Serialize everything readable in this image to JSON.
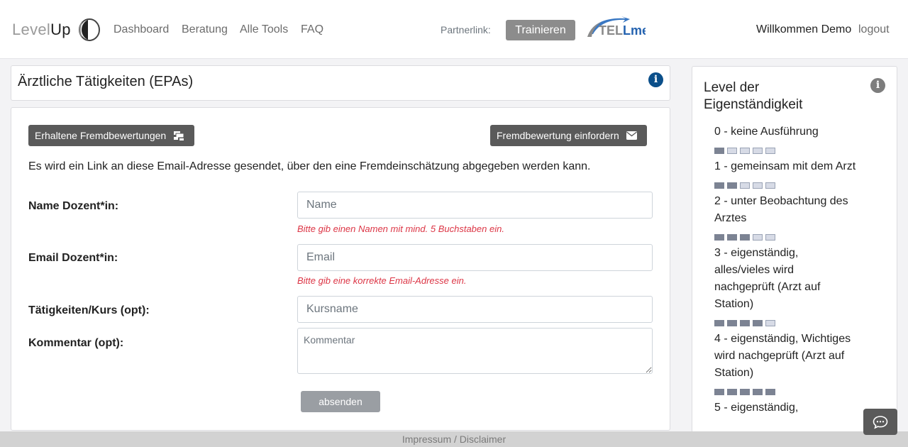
{
  "logo": {
    "level": "Level",
    "up": "Up"
  },
  "nav": {
    "links": [
      "Dashboard",
      "Beratung",
      "Alle Tools",
      "FAQ"
    ],
    "partner_label": "Partnerlink:",
    "train_button": "Trainieren",
    "partner_logo": {
      "tel": "TEL",
      "lme": "Lme"
    },
    "welcome": "Willkommen Demo",
    "logout": "logout"
  },
  "page": {
    "title": "Ärztliche Tätigkeiten (EPAs)"
  },
  "form": {
    "received_button": "Erhaltene Fremdbewertungen",
    "request_button": "Fremdbewertung einfordern",
    "intro": "Es wird ein Link an diese Email-Adresse gesendet, über den eine Fremdeinschätzung abgegeben werden kann.",
    "name_label": "Name Dozent*in:",
    "name_placeholder": "Name",
    "name_error": "Bitte gib einen Namen mit mind. 5 Buchstaben ein.",
    "email_label": "Email Dozent*in:",
    "email_placeholder": "Email",
    "email_error": "Bitte gib eine korrekte Email-Adresse ein.",
    "course_label": "Tätigkeiten/Kurs (opt):",
    "course_placeholder": "Kursname",
    "comment_label": "Kommentar (opt):",
    "comment_placeholder": "Kommentar",
    "submit": "absenden"
  },
  "sidebar": {
    "title": "Level der Eigenständigkeit",
    "levels": [
      {
        "label": "0 - keine Ausführung",
        "filled": 0
      },
      {
        "label": "1 - gemeinsam mit dem Arzt",
        "filled": 1
      },
      {
        "label": "2 - unter Beobachtung des Arztes",
        "filled": 2
      },
      {
        "label": "3 - eigenständig, alles/vieles wird nachgeprüft (Arzt auf Station)",
        "filled": 3
      },
      {
        "label": "4 - eigenständig, Wichtiges wird nachgeprüft (Arzt auf Station)",
        "filled": 4
      },
      {
        "label": "5 - eigenständig,",
        "filled": 5
      }
    ],
    "squares_total": 5
  },
  "footer": {
    "text": "Impressum / Disclaimer"
  },
  "icons": [
    "info-icon",
    "inbox-icon",
    "envelope-icon",
    "chat-icon"
  ],
  "colors": {
    "info_blue": "#0b4f8a",
    "error_red": "#dc3545",
    "dark_button": "#5a5a5a"
  }
}
